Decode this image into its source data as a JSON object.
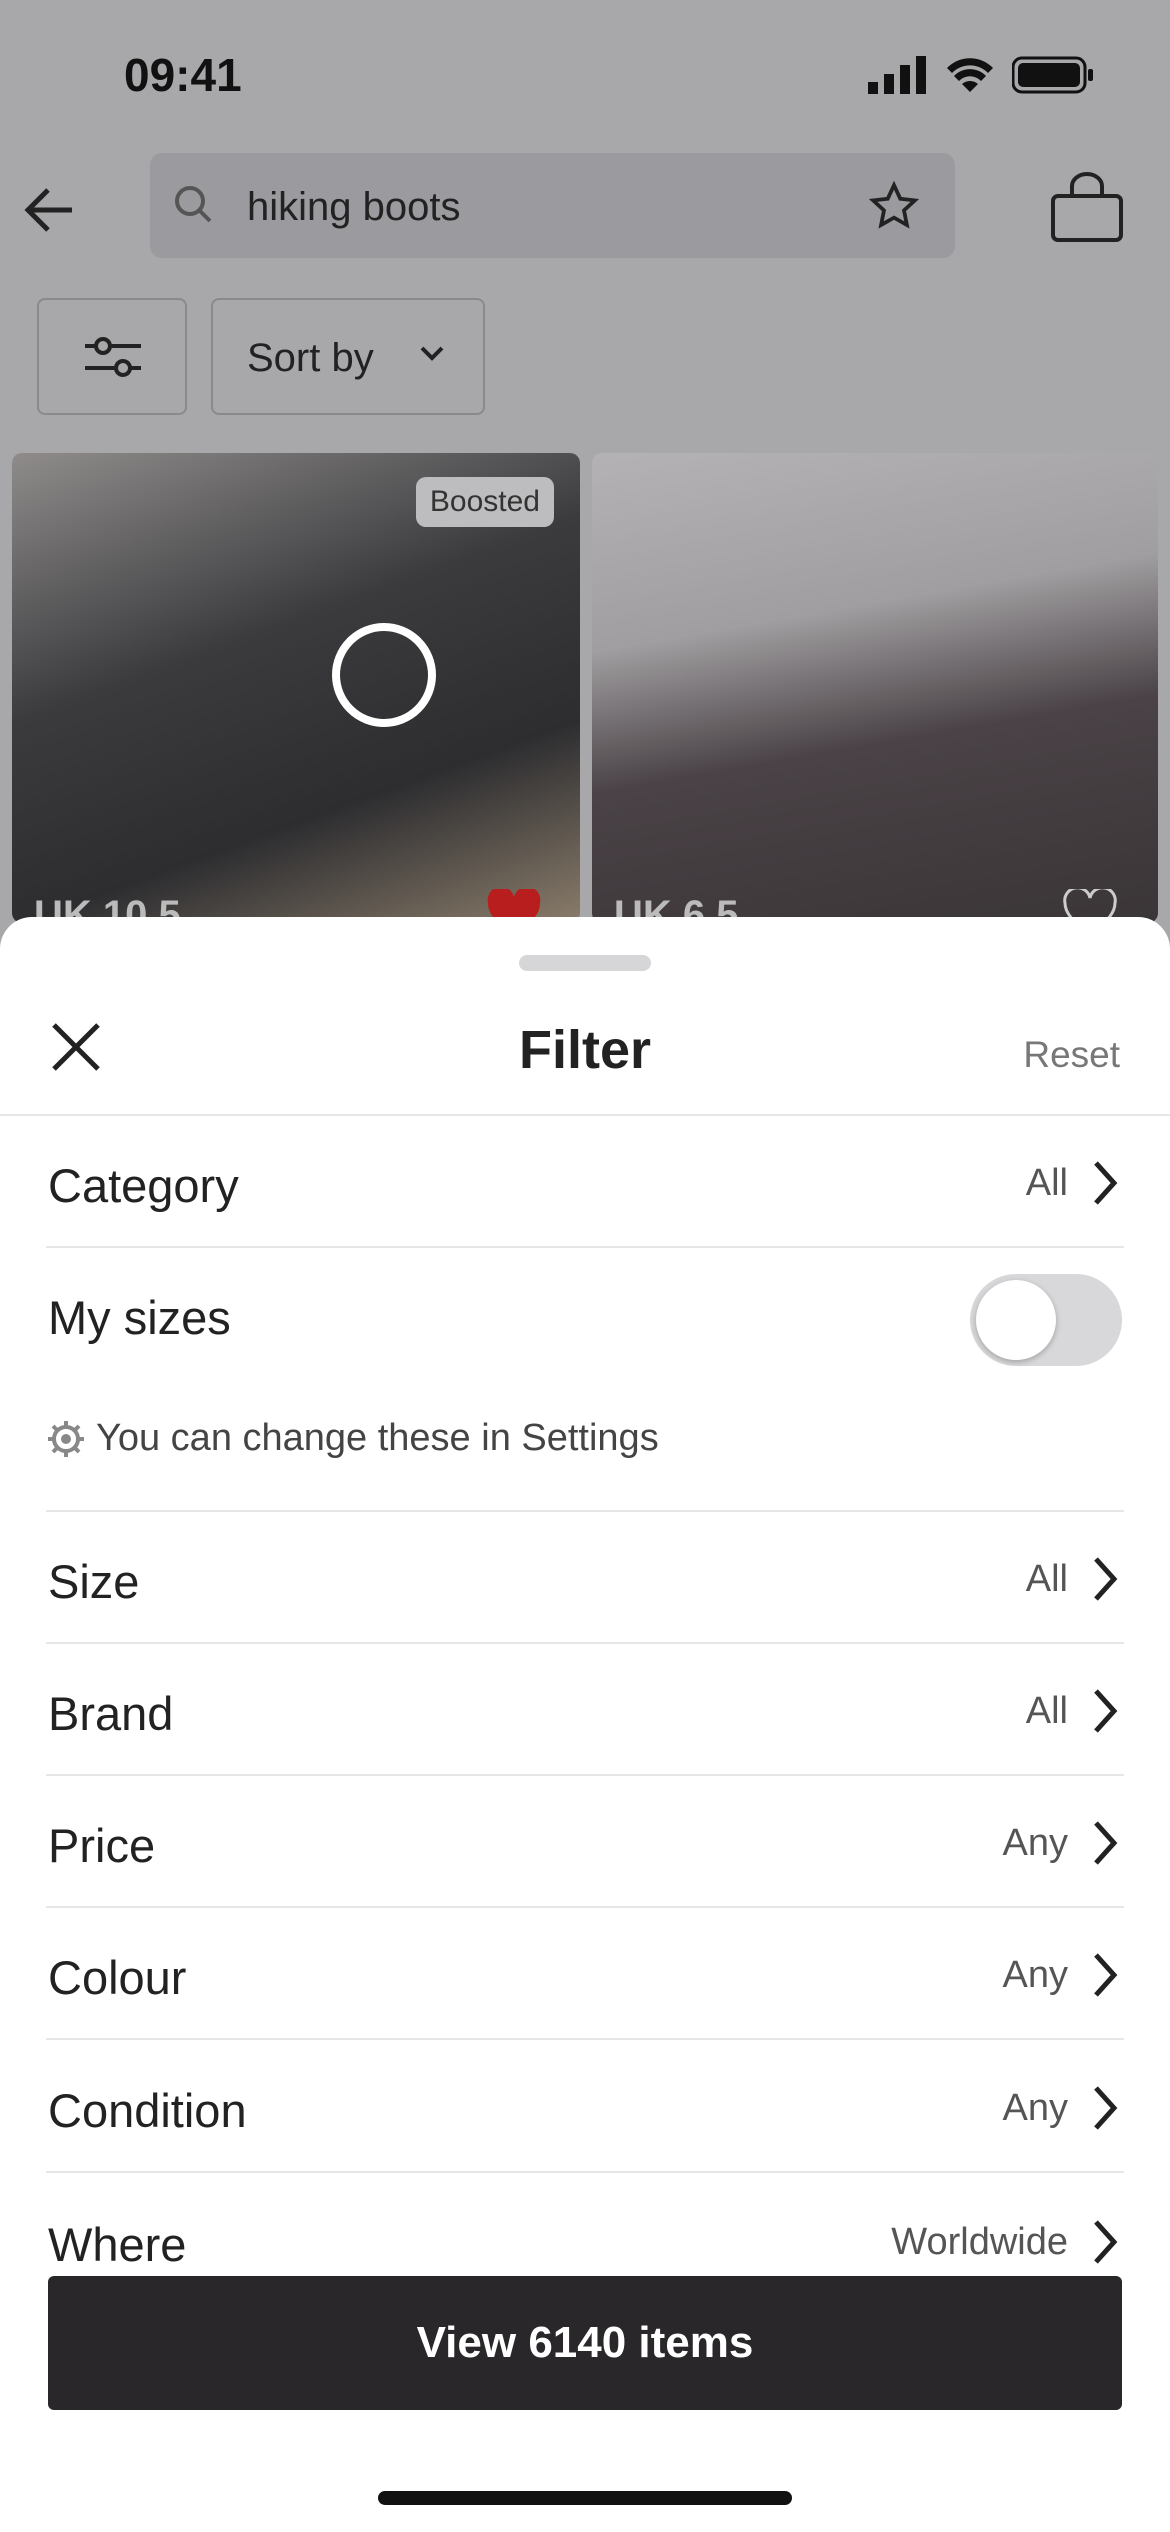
{
  "status": {
    "time": "09:41"
  },
  "search": {
    "query": "hiking boots"
  },
  "toolbar": {
    "sort_label": "Sort by"
  },
  "products": [
    {
      "badge": "Boosted",
      "size": "UK 10.5",
      "liked": true
    },
    {
      "size": "UK 6.5",
      "liked": false
    }
  ],
  "filter": {
    "title": "Filter",
    "reset": "Reset",
    "rows": [
      {
        "label": "Category",
        "value": "All"
      },
      {
        "label": "My sizes",
        "toggle": false
      },
      {
        "label": "Size",
        "value": "All"
      },
      {
        "label": "Brand",
        "value": "All"
      },
      {
        "label": "Price",
        "value": "Any"
      },
      {
        "label": "Colour",
        "value": "Any"
      },
      {
        "label": "Condition",
        "value": "Any"
      },
      {
        "label": "Where",
        "value": "Worldwide"
      }
    ],
    "settings_note": "You can change these in Settings",
    "cta": "View 6140 items"
  },
  "colors": {
    "cta": "#29272a",
    "overlay": "#a8a7aa"
  }
}
